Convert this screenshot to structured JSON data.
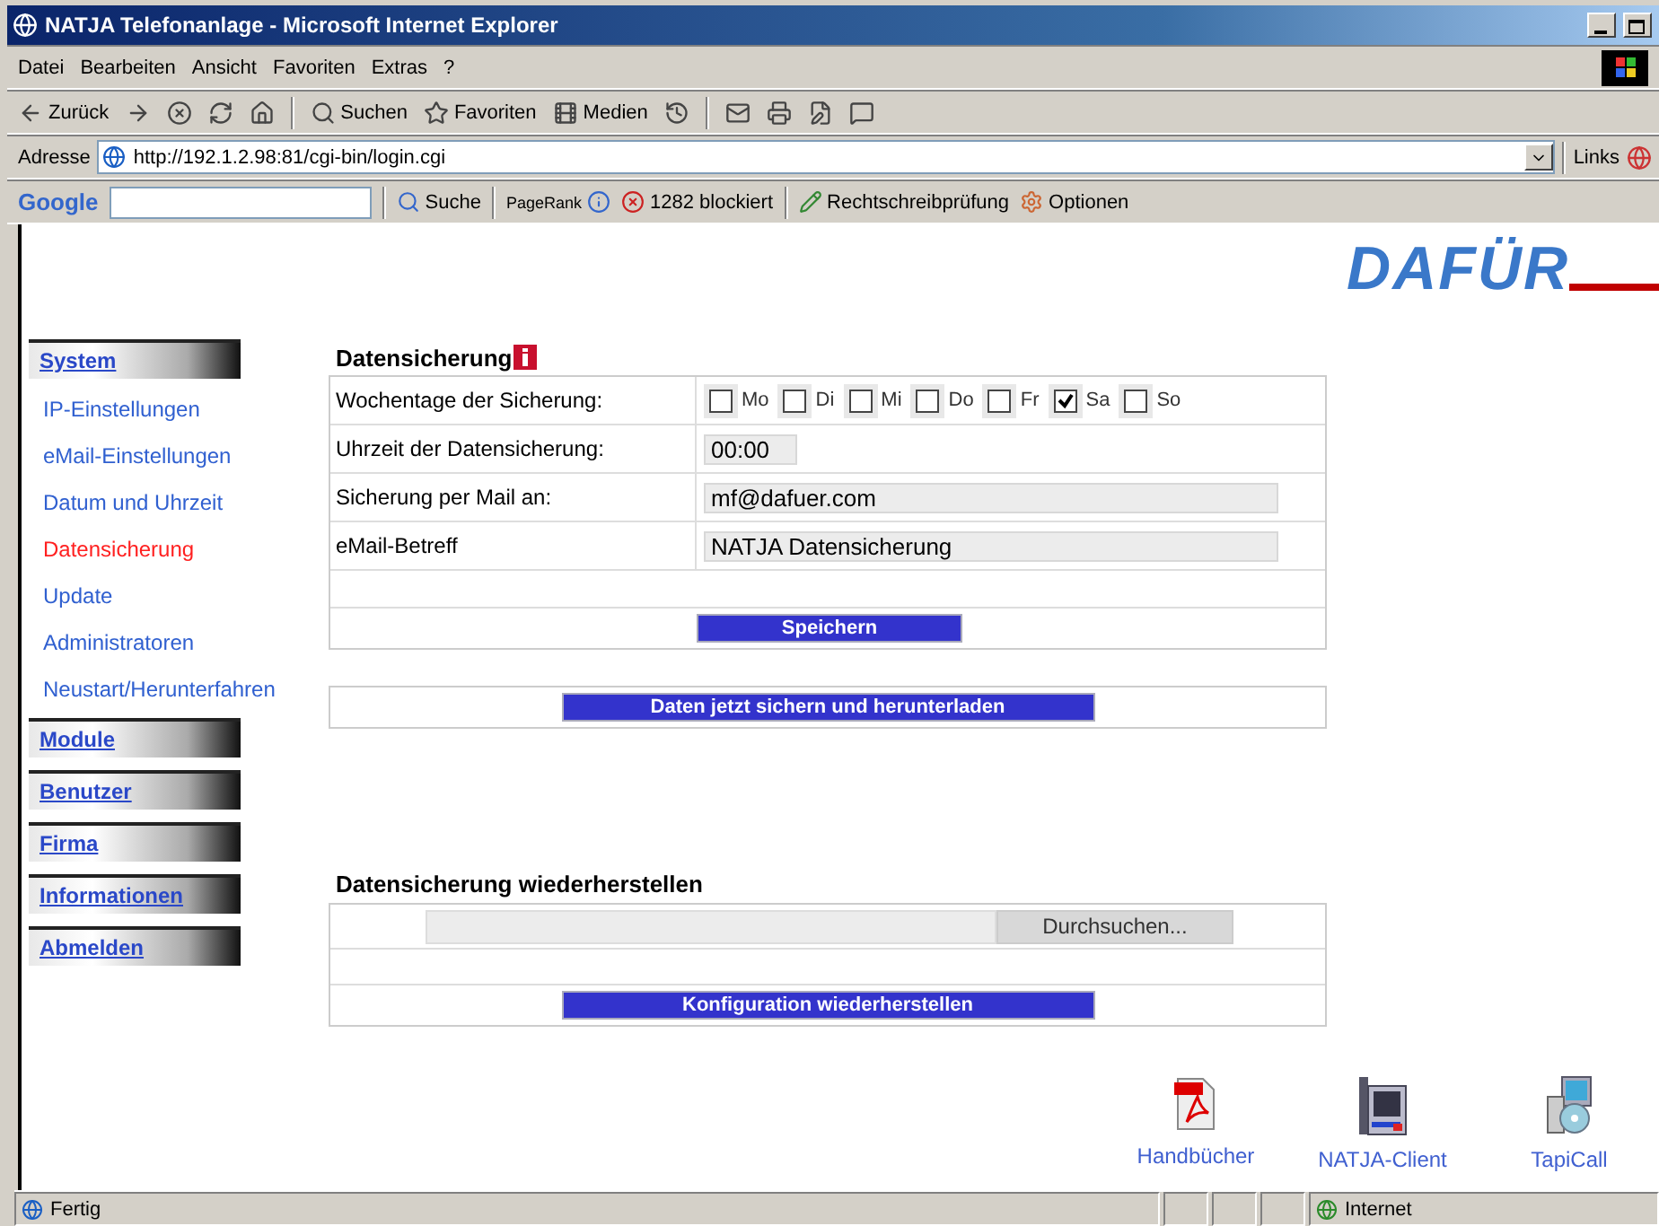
{
  "window": {
    "title": "NATJA Telefonanlage - Microsoft Internet Explorer"
  },
  "menu": [
    "Datei",
    "Bearbeiten",
    "Ansicht",
    "Favoriten",
    "Extras",
    "?"
  ],
  "toolbar": [
    {
      "kind": "back",
      "label": "Zurück"
    },
    {
      "kind": "forward"
    },
    {
      "kind": "stop"
    },
    {
      "kind": "refresh"
    },
    {
      "kind": "home"
    },
    {
      "kind": "search",
      "label": "Suchen"
    },
    {
      "kind": "favorites",
      "label": "Favoriten"
    },
    {
      "kind": "media",
      "label": "Medien"
    },
    {
      "kind": "history"
    },
    {
      "kind": "mail"
    },
    {
      "kind": "print"
    },
    {
      "kind": "edit"
    },
    {
      "kind": "discuss"
    }
  ],
  "address": {
    "label": "Adresse",
    "value": "http://192.1.2.98:81/cgi-bin/login.cgi",
    "links": "Links"
  },
  "google_bar": {
    "logo": "Google",
    "search": "Suche",
    "pagerank": "PageRank",
    "blocked": "1282 blockiert",
    "spelling": "Rechtschreibprüfung",
    "options": "Optionen"
  },
  "logo": "DAFÜR",
  "sidebar": [
    {
      "kind": "section",
      "label": "System",
      "selected": false
    },
    {
      "kind": "link",
      "label": "IP-Einstellungen",
      "selected": false
    },
    {
      "kind": "link",
      "label": "eMail-Einstellungen",
      "selected": false
    },
    {
      "kind": "link",
      "label": "Datum und Uhrzeit",
      "selected": false
    },
    {
      "kind": "link",
      "label": "Datensicherung",
      "selected": true
    },
    {
      "kind": "link",
      "label": "Update",
      "selected": false
    },
    {
      "kind": "link",
      "label": "Administratoren",
      "selected": false
    },
    {
      "kind": "link",
      "label": "Neustart/Herunterfahren",
      "selected": false
    },
    {
      "kind": "section",
      "label": "Module",
      "selected": false
    },
    {
      "kind": "section",
      "label": "Benutzer",
      "selected": false
    },
    {
      "kind": "section",
      "label": "Firma",
      "selected": false
    },
    {
      "kind": "section",
      "label": "Informationen",
      "selected": false
    },
    {
      "kind": "section",
      "label": "Abmelden",
      "selected": false
    }
  ],
  "backup": {
    "title": "Datensicherung",
    "weekdays_label": "Wochentage der Sicherung:",
    "weekdays": [
      {
        "label": "Mo",
        "checked": false
      },
      {
        "label": "Di",
        "checked": false
      },
      {
        "label": "Mi",
        "checked": false
      },
      {
        "label": "Do",
        "checked": false
      },
      {
        "label": "Fr",
        "checked": false
      },
      {
        "label": "Sa",
        "checked": true
      },
      {
        "label": "So",
        "checked": false
      }
    ],
    "fields": [
      {
        "label": "Uhrzeit der Datensicherung:",
        "value": "00:00",
        "kind": "short"
      },
      {
        "label": "Sicherung per Mail an:",
        "value": "mf@dafuer.com",
        "kind": "long"
      },
      {
        "label": "eMail-Betreff",
        "value": "NATJA Datensicherung",
        "kind": "long"
      }
    ],
    "save": "Speichern",
    "download": "Daten jetzt sichern und herunterladen"
  },
  "restore": {
    "title": "Datensicherung wiederherstellen",
    "browse": "Durchsuchen...",
    "submit": "Konfiguration wiederherstellen"
  },
  "downloads": [
    {
      "kind": "pdf",
      "label": "Handbücher"
    },
    {
      "kind": "phone",
      "label": "NATJA-Client"
    },
    {
      "kind": "setup",
      "label": "TapiCall"
    }
  ],
  "status_bar": {
    "text": "Fertig",
    "zone": "Internet"
  }
}
